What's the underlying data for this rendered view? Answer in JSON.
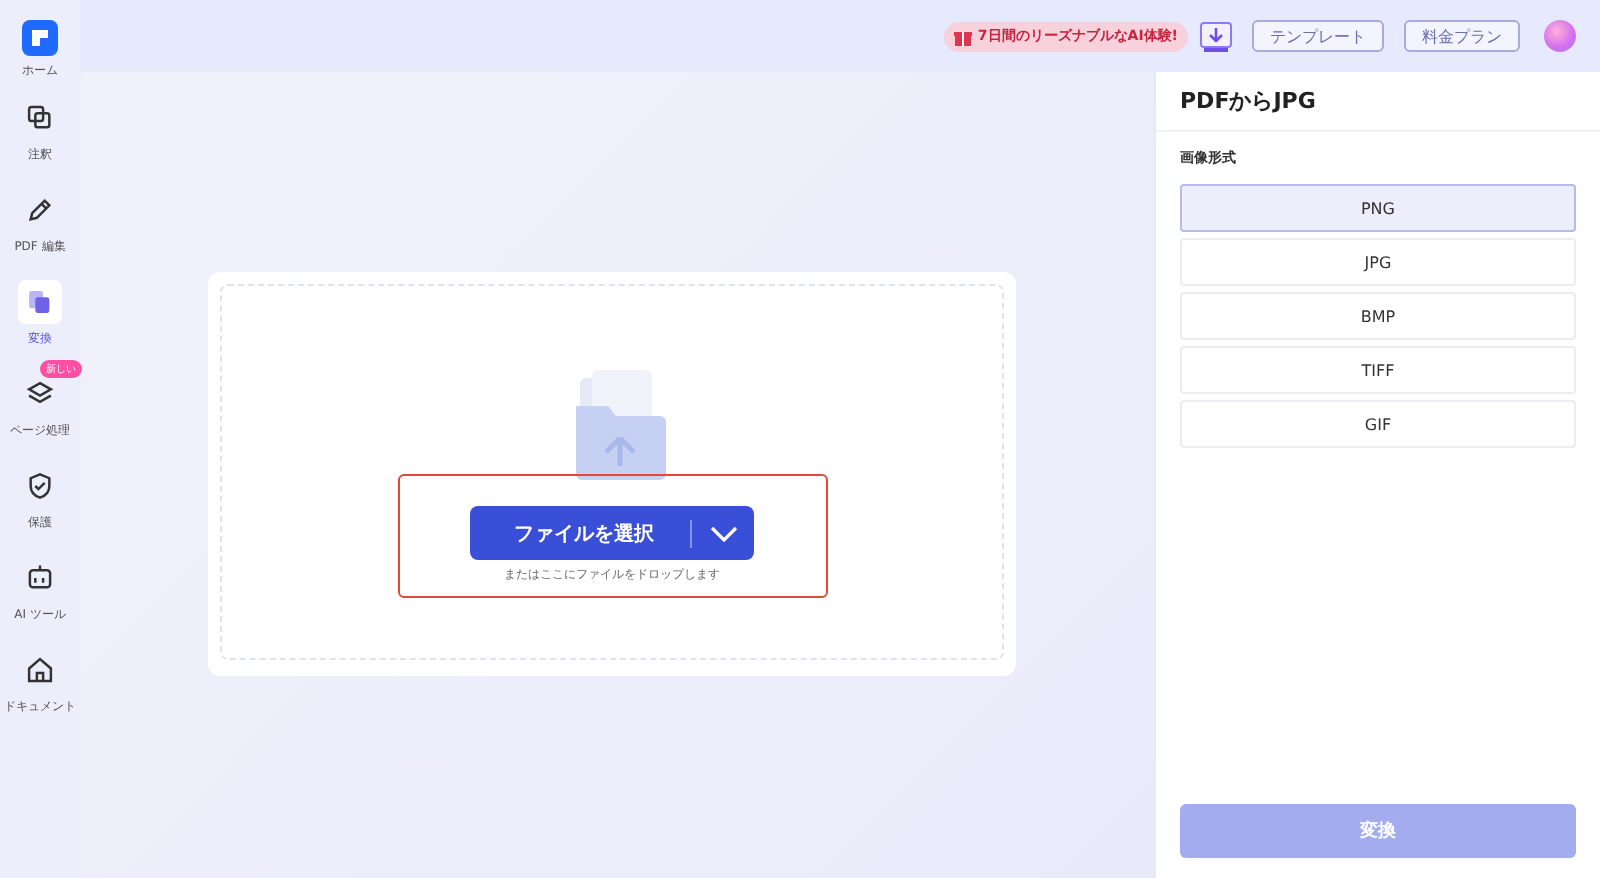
{
  "sidebar": {
    "items": [
      {
        "label": "ホーム",
        "kind": "logo",
        "selected": false
      },
      {
        "label": "注釈",
        "kind": "annotate",
        "selected": false
      },
      {
        "label": "PDF 編集",
        "kind": "edit",
        "selected": false
      },
      {
        "label": "変換",
        "kind": "convert",
        "selected": true
      },
      {
        "label": "ページ処理",
        "kind": "pages",
        "selected": false,
        "badge": "新しい"
      },
      {
        "label": "保護",
        "kind": "protect",
        "selected": false
      },
      {
        "label": "AI ツール",
        "kind": "ai",
        "selected": false
      },
      {
        "label": "ドキュメント",
        "kind": "home",
        "selected": false
      }
    ]
  },
  "top_bar": {
    "promo": "7日間のリーズナブルなAI体験!",
    "buttons": [
      "テンプレート",
      "料金プラン"
    ]
  },
  "upload": {
    "button": "ファイルを選択",
    "hint": "またはここにファイルをドロップします"
  },
  "panel": {
    "title": "PDFからJPG",
    "section": "画像形式",
    "options": [
      {
        "label": "PNG",
        "selected": true
      },
      {
        "label": "JPG",
        "selected": false
      },
      {
        "label": "BMP",
        "selected": false
      },
      {
        "label": "TIFF",
        "selected": false
      },
      {
        "label": "GIF",
        "selected": false
      }
    ],
    "action": {
      "label": "変換",
      "disabled": true
    }
  }
}
